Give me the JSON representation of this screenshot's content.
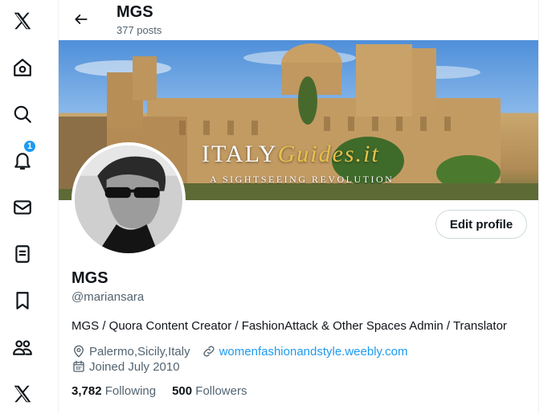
{
  "nav": {
    "items": [
      {
        "name": "x-logo-icon"
      },
      {
        "name": "home-icon"
      },
      {
        "name": "search-icon"
      },
      {
        "name": "notifications-icon",
        "badge": "1"
      },
      {
        "name": "messages-icon"
      },
      {
        "name": "lists-icon"
      },
      {
        "name": "bookmarks-icon"
      },
      {
        "name": "communities-icon"
      },
      {
        "name": "premium-x-icon"
      }
    ]
  },
  "header": {
    "name": "MGS",
    "posts": "377 posts"
  },
  "banner": {
    "brand_main": "ITALY",
    "brand_accent": "Guides.it",
    "tagline": "A SIGHTSEEING REVOLUTION"
  },
  "profile": {
    "edit_label": "Edit profile",
    "name": "MGS",
    "handle": "@mariansara",
    "bio": "MGS / Quora Content Creator / FashionAttack & Other Spaces Admin / Translator",
    "location": "Palermo,Sicily,Italy",
    "website": "womenfashionandstyle.weebly.com",
    "joined": "Joined July 2010",
    "following_count": "3,782",
    "following_label": "Following",
    "followers_count": "500",
    "followers_label": "Followers"
  },
  "colors": {
    "accent": "#1d9bf0",
    "text": "#0f1419",
    "muted": "#536471"
  }
}
